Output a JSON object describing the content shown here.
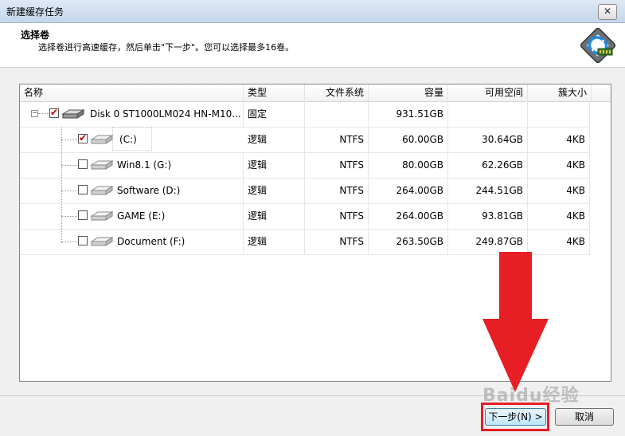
{
  "window": {
    "title": "新建缓存任务",
    "close_glyph": "✕"
  },
  "header": {
    "title": "选择卷",
    "subtitle": "选择卷进行高速缓存，然后单击\"下一步\"。您可以选择最多16卷。",
    "logo_icon": "primocache-logo-icon"
  },
  "table": {
    "columns": [
      "名称",
      "类型",
      "文件系统",
      "容量",
      "可用空间",
      "簇大小"
    ],
    "disk": {
      "name": "Disk 0 ST1000LM024 HN-M10...",
      "type": "固定",
      "fs": "",
      "capacity": "931.51GB",
      "free": "",
      "cluster": "",
      "checked": true
    },
    "volumes": [
      {
        "name": "(C:)",
        "type": "逻辑",
        "fs": "NTFS",
        "capacity": "60.00GB",
        "free": "30.64GB",
        "cluster": "4KB",
        "checked": true
      },
      {
        "name": "Win8.1 (G:)",
        "type": "逻辑",
        "fs": "NTFS",
        "capacity": "80.00GB",
        "free": "62.26GB",
        "cluster": "4KB",
        "checked": false
      },
      {
        "name": "Software (D:)",
        "type": "逻辑",
        "fs": "NTFS",
        "capacity": "264.00GB",
        "free": "244.51GB",
        "cluster": "4KB",
        "checked": false
      },
      {
        "name": "GAME (E:)",
        "type": "逻辑",
        "fs": "NTFS",
        "capacity": "264.00GB",
        "free": "93.81GB",
        "cluster": "4KB",
        "checked": false
      },
      {
        "name": "Document (F:)",
        "type": "逻辑",
        "fs": "NTFS",
        "capacity": "263.50GB",
        "free": "249.87GB",
        "cluster": "4KB",
        "checked": false
      }
    ]
  },
  "footer": {
    "next_label": "下一步(N) >",
    "cancel_label": "取消"
  },
  "annotation": {
    "arrow_color": "#e81e25",
    "watermark": "Baidu经验"
  }
}
